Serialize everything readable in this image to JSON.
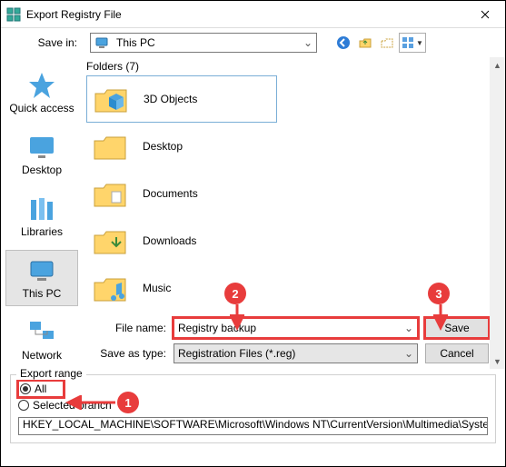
{
  "window": {
    "title": "Export Registry File"
  },
  "savein": {
    "label": "Save in:",
    "value": "This PC"
  },
  "places": {
    "quick": "Quick access",
    "desktop": "Desktop",
    "libraries": "Libraries",
    "thispc": "This PC",
    "network": "Network"
  },
  "folders": {
    "header": "Folders (7)",
    "items": [
      {
        "name": "3D Objects"
      },
      {
        "name": "Desktop"
      },
      {
        "name": "Documents"
      },
      {
        "name": "Downloads"
      },
      {
        "name": "Music"
      }
    ]
  },
  "filename": {
    "label": "File name:",
    "value": "Registry backup"
  },
  "saveas": {
    "label": "Save as type:",
    "value": "Registration Files (*.reg)"
  },
  "buttons": {
    "save": "Save",
    "cancel": "Cancel"
  },
  "export_range": {
    "title": "Export range",
    "all": "All",
    "selected": "Selected branch",
    "branch_value": "HKEY_LOCAL_MACHINE\\SOFTWARE\\Microsoft\\Windows NT\\CurrentVersion\\Multimedia\\SystemPro"
  },
  "annotations": {
    "b1": "1",
    "b2": "2",
    "b3": "3"
  }
}
